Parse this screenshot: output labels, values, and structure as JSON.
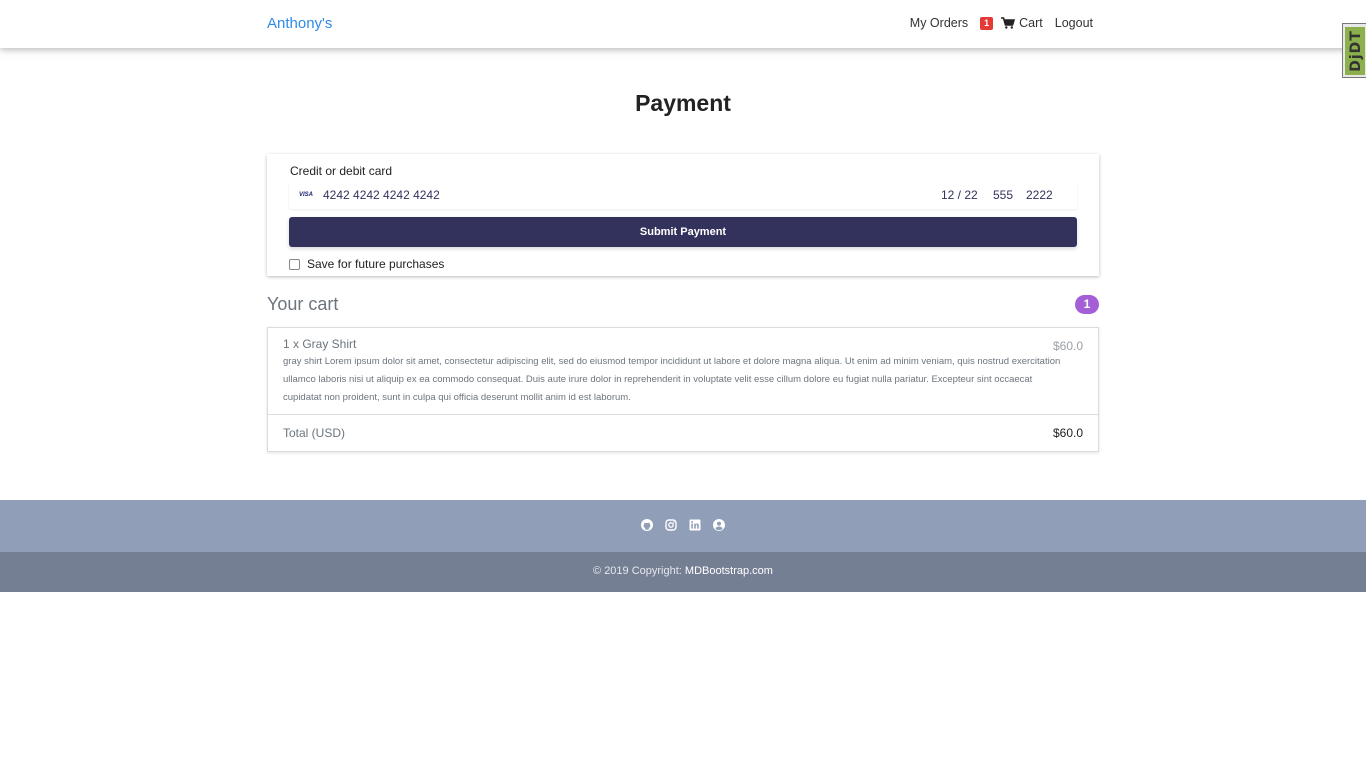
{
  "navbar": {
    "brand": "Anthony's",
    "my_orders": "My Orders",
    "cart_badge": "1",
    "cart_label": "Cart",
    "logout": "Logout"
  },
  "debug_tab": {
    "label": "DjDT"
  },
  "page": {
    "title": "Payment"
  },
  "payment": {
    "card_label": "Credit or debit card",
    "card_brand": "VISA",
    "card_number": "4242 4242 4242 4242",
    "expiry": "12 / 22",
    "cvc": "555",
    "zip": "2222",
    "submit_label": "Submit Payment",
    "save_label": "Save for future purchases",
    "save_checked": false
  },
  "cart": {
    "title": "Your cart",
    "count": "1",
    "items": [
      {
        "name": "1 x Gray Shirt",
        "description": "gray shirt Lorem ipsum dolor sit amet, consectetur adipiscing elit, sed do eiusmod tempor incididunt ut labore et dolore magna aliqua. Ut enim ad minim veniam, quis nostrud exercitation ullamco laboris nisi ut aliquip ex ea commodo consequat. Duis aute irure dolor in reprehenderit in voluptate velit esse cillum dolore eu fugiat nulla pariatur. Excepteur sint occaecat cupidatat non proident, sunt in culpa qui officia deserunt mollit anim id est laborum.",
        "price": "$60.0"
      }
    ],
    "total_label": "Total (USD)",
    "total_value": "$60.0"
  },
  "footer": {
    "social_icons": [
      "github-icon",
      "instagram-icon",
      "linkedin-icon",
      "user-circle-icon"
    ],
    "copyright_prefix": "© 2019 Copyright:",
    "copyright_link": "MDBootstrap.com"
  },
  "colors": {
    "brand": "#2f8ae8",
    "submit_button": "#32325d",
    "cart_badge": "#a45ed6",
    "nav_badge": "#e53935",
    "footer_top": "#919eb7",
    "footer_bottom": "#757f94"
  }
}
